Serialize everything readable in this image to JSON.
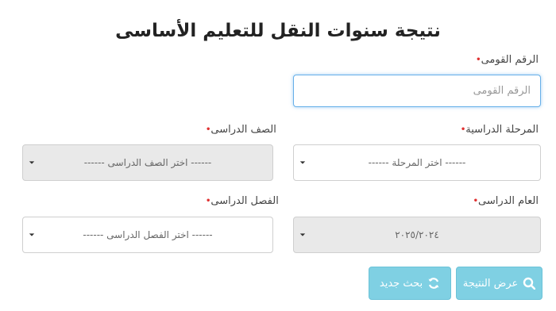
{
  "page": {
    "title": "نتيجة سنوات النقل للتعليم الأساسى"
  },
  "form": {
    "required_marker": "•",
    "national_id": {
      "label": "الرقم القومى",
      "placeholder": "الرقم القومى",
      "value": ""
    },
    "stage": {
      "label": "المرحلة الدراسية",
      "selected": "------ اختر المرحلة ------"
    },
    "grade": {
      "label": "الصف الدراسى",
      "selected": "------ اختر الصف الدراسى ------"
    },
    "academic_year": {
      "label": "العام الدراسى",
      "selected": "٢٠٢٥/٢٠٢٤"
    },
    "term": {
      "label": "الفصل الدراسى",
      "selected": "------ اختر الفصل الدراسى ------"
    }
  },
  "buttons": {
    "show_result": "عرض النتيجة",
    "new_search": "بحث جديد"
  },
  "colors": {
    "button_bg": "#7fd0e3",
    "focus_border": "#66afe9",
    "required": "#e03131",
    "disabled_select_bg": "#e9e9e9"
  },
  "icons": {
    "show_result": "search-icon",
    "new_search": "refresh-icon",
    "select": "chevron-down-icon"
  }
}
